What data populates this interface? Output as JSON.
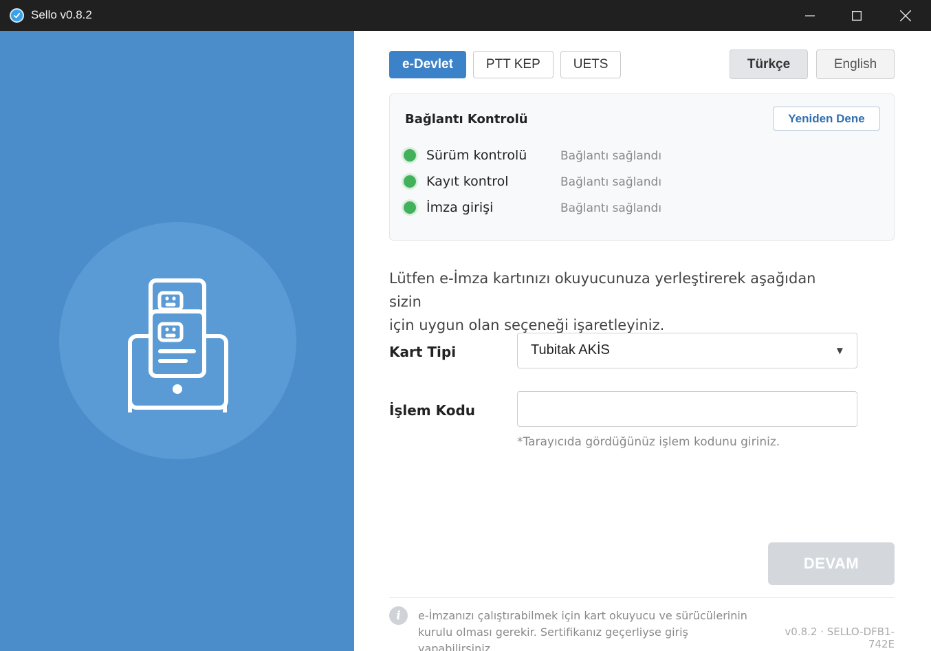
{
  "window": {
    "title": "Sello v0.8.2",
    "minimize_icon": "minimize-icon",
    "maximize_icon": "maximize-icon",
    "close_icon": "close-icon"
  },
  "hero": {
    "icon": "card-reader-icon"
  },
  "tabs": [
    {
      "label": "e-Devlet",
      "active": true
    },
    {
      "label": "PTT KEP",
      "active": false
    },
    {
      "label": "UETS",
      "active": false
    }
  ],
  "languages": [
    {
      "label": "Türkçe",
      "active": true
    },
    {
      "label": "English",
      "active": false
    }
  ],
  "connection": {
    "title": "Bağlantı Kontrolü",
    "retry_label": "Yeniden Dene",
    "checks": [
      {
        "label": "Sürüm kontrolü",
        "status": "Bağlantı sağlandı"
      },
      {
        "label": "Kayıt kontrol",
        "status": "Bağlantı sağlandı"
      },
      {
        "label": "İmza girişi",
        "status": "Bağlantı sağlandı"
      }
    ]
  },
  "instructions": {
    "line1": "Lütfen e-İmza kartınızı okuyucunuza yerleştirerek aşağıdan sizin",
    "line2": "için uygun olan seçeneği işaretleyiniz."
  },
  "form": {
    "card_type_label": "Kart Tipi",
    "card_type_value": "Tubitak AKİS",
    "code_label": "İşlem Kodu",
    "code_value": "",
    "code_hint": "*Tarayıcıda gördüğünüz işlem kodunu giriniz."
  },
  "continue_label": "DEVAM",
  "footer": {
    "info_line1": "e-İmzanızı çalıştırabilmek için kart okuyucu ve sürücülerinin",
    "info_line2": "kurulu olması gerekir. Sertifikanız geçerliyse giriş yapabilirsiniz.",
    "version": "v0.8.2 · SELLO-DFB1-742E"
  },
  "colors": {
    "accent": "#3c82c8",
    "left_panel": "#4b8cca",
    "status_ok": "#43b05c"
  }
}
